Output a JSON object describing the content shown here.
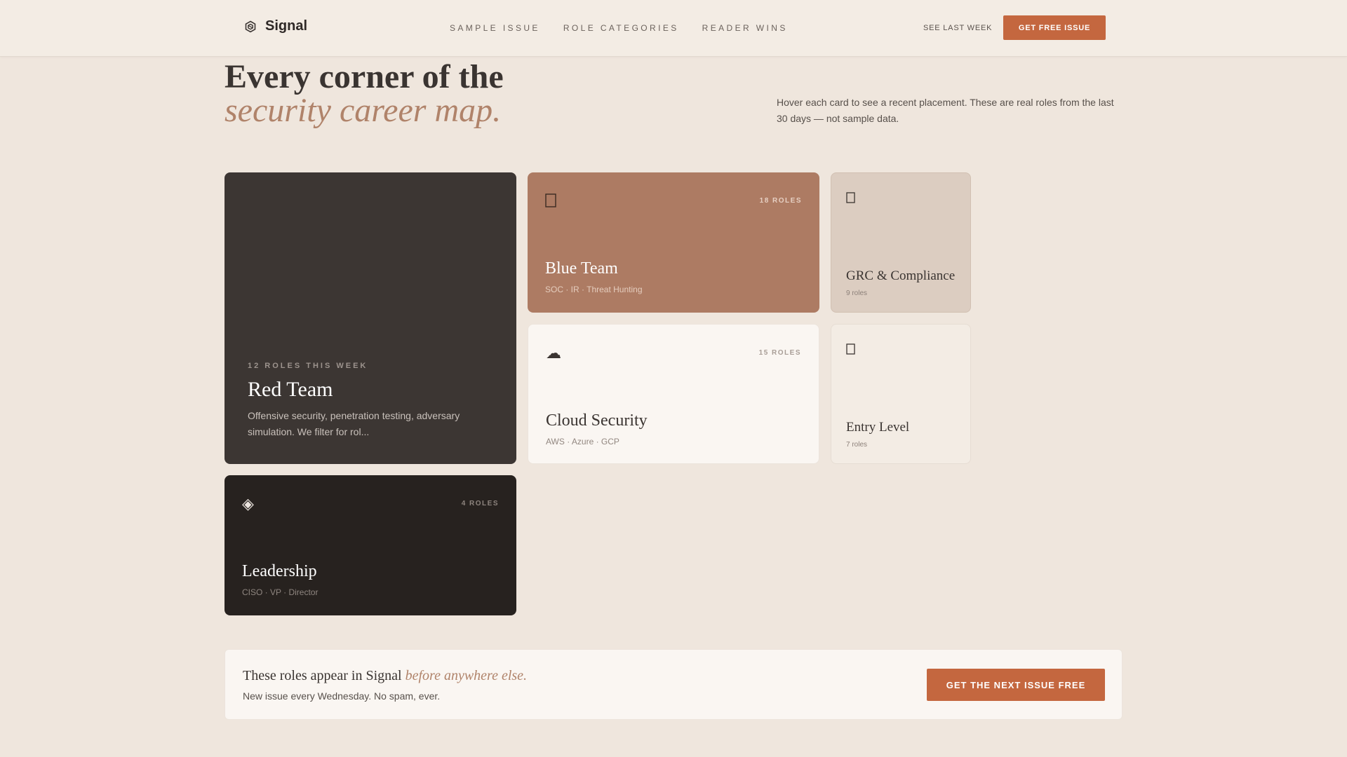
{
  "header": {
    "brand": "Signal",
    "nav": [
      "SAMPLE ISSUE",
      "ROLE CATEGORIES",
      "READER WINS"
    ],
    "see_last_week": "SEE LAST WEEK",
    "cta_label": "GET FREE ISSUE"
  },
  "hero": {
    "title_line1": "Every corner of the",
    "title_line2": "security career map.",
    "description": "Hover each card to see a recent placement. These are real roles from the last 30 days — not sample data."
  },
  "cards": {
    "red_team": {
      "eyebrow": "12 ROLES THIS WEEK",
      "title": "Red Team",
      "description": "Offensive security, penetration testing, adversary simulation. We filter for rol..."
    },
    "blue_team": {
      "icon": "shield-icon",
      "count": "18 ROLES",
      "title": "Blue Team",
      "subtitle": "SOC · IR · Threat Hunting"
    },
    "grc": {
      "icon": "document-icon",
      "title": "GRC & Compliance",
      "subtitle": "9 roles"
    },
    "cloud": {
      "icon": "cloud-icon",
      "glyph": "☁",
      "count": "15 ROLES",
      "title": "Cloud Security",
      "subtitle": "AWS · Azure · GCP"
    },
    "entry": {
      "icon": "seedling-icon",
      "title": "Entry Level",
      "subtitle": "7 roles"
    },
    "leadership": {
      "icon": "diamond-icon",
      "glyph": "◈",
      "count": "4 ROLES",
      "title": "Leadership",
      "subtitle": "CISO · VP · Director"
    }
  },
  "cta": {
    "title_prefix": "These roles appear in Signal ",
    "title_accent": "before anywhere else.",
    "subtitle": "New issue every Wednesday. No spam, ever.",
    "button_label": "GET THE NEXT ISSUE FREE"
  },
  "colors": {
    "background": "#efe6dd",
    "accent": "#c4673f",
    "italic_accent": "#b0836a",
    "red_team_card": "#3c3633",
    "blue_team_card": "#ad7b63",
    "leadership_card": "#27221f"
  }
}
